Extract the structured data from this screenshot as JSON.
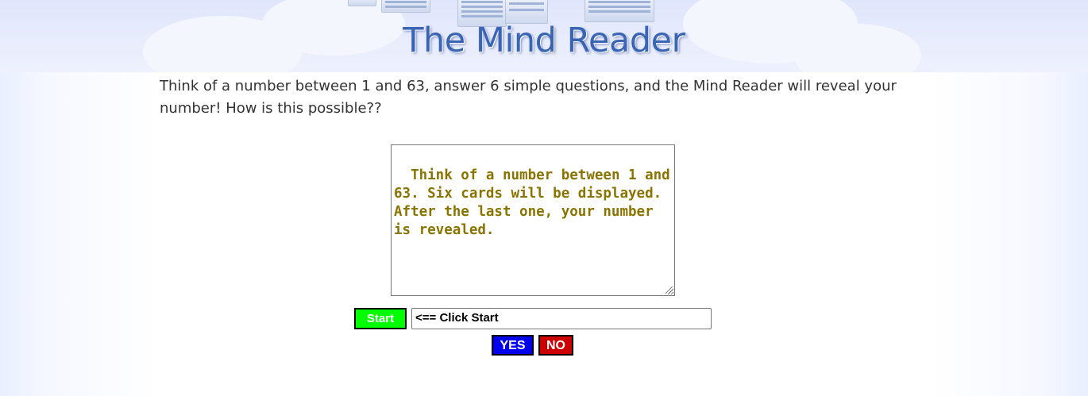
{
  "header": {
    "title": "The Mind Reader"
  },
  "intro": {
    "text": "Think of a number between 1 and 63, answer 6 simple questions, and the Mind Reader will reveal your number! How is this possible??"
  },
  "card_display": {
    "text": "Think of a number between 1 and 63. Six cards will be displayed. After the last one, your number is revealed."
  },
  "controls": {
    "start_label": "Start",
    "status_text": "<== Click Start",
    "yes_label": "YES",
    "no_label": "NO"
  },
  "colors": {
    "title": "#3a64b4",
    "card_text": "#8a7400",
    "start": "#00ff00",
    "yes": "#0000ee",
    "no": "#cc0000"
  }
}
